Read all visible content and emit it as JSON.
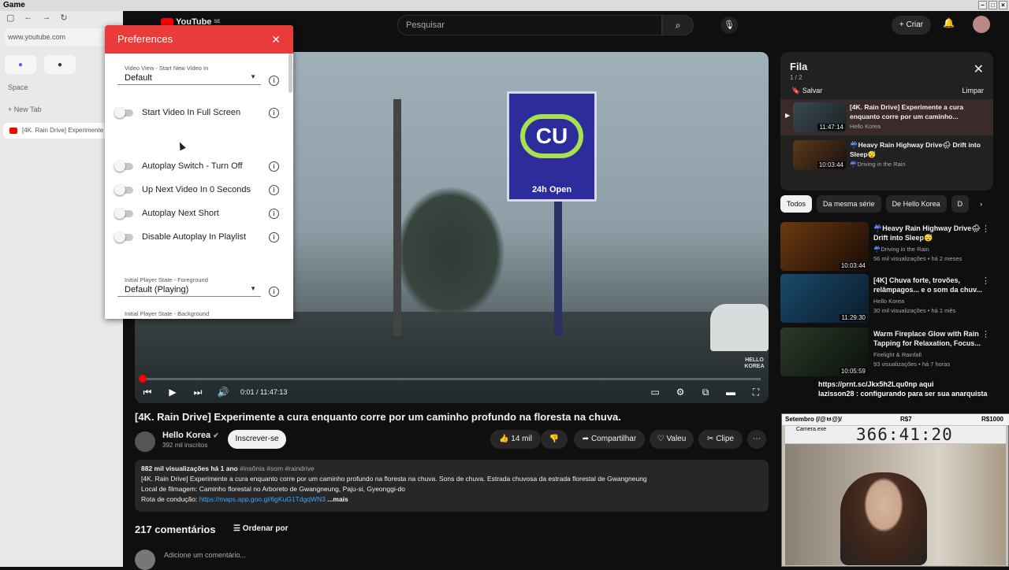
{
  "window": {
    "title": "Game"
  },
  "browser": {
    "url": "www.youtube.com",
    "space_label": "Space",
    "new_tab_label": "New Tab",
    "tab_label": "[4K. Rain Drive] Experimente"
  },
  "topbar": {
    "logo_label": "YouTube",
    "logo_region": "SE",
    "search_placeholder": "Pesquisar",
    "create_label": "Criar"
  },
  "preferences": {
    "title": "Preferences",
    "video_view_label": "Video View - Start New Video In",
    "video_view_value": "Default",
    "toggles": [
      "Start Video In Full Screen",
      "Autoplay Switch - Turn Off",
      "Up Next Video In 0 Seconds",
      "Autoplay Next Short",
      "Disable Autoplay In Playlist"
    ],
    "fg_label": "Initial Player State - Foreground",
    "fg_value": "Default (Playing)",
    "bg_label": "Initial Player State - Background"
  },
  "player": {
    "sign_text": "CU",
    "sign_sub": "24h Open",
    "watermark": "HELLO KOREA",
    "time": "0:01 / 11:47:13",
    "progress": 0.0
  },
  "video": {
    "title": "[4K. Rain Drive] Experimente a cura enquanto corre por um caminho profundo na floresta na chuva.",
    "channel": "Hello Korea",
    "subscribers": "392 mil inscritos",
    "subscribe_label": "Inscrever-se",
    "likes": "14 mil",
    "share_label": "Compartilhar",
    "thanks_label": "Valeu",
    "clip_label": "Clipe",
    "desc_meta": "882 mil visualizações  há 1 ano",
    "desc_tags": "#insônia #som #raindrive",
    "desc_line1": "[4K. Rain Drive] Experimente a cura enquanto corre por um caminho profundo na floresta na chuva. Sons de chuva. Estrada chuvosa da estrada florestal de Gwangneung",
    "desc_line2": "Local de filmagem: Caminho florestal no Arboreto de Gwangneung, Paju-si, Gyeonggi-do",
    "desc_line3_prefix": "Rota de condução: ",
    "desc_link": "https://maps.app.goo.gl/6gKuG1TdgqWN3",
    "desc_more": "...mais",
    "comments_count": "217 comentários",
    "sort_label": "Ordenar por",
    "add_comment": "Adicione um comentário..."
  },
  "queue": {
    "title": "Fila",
    "count": "1 / 2",
    "save_label": "Salvar",
    "clear_label": "Limpar",
    "items": [
      {
        "title": "[4K. Rain Drive] Experimente a cura enquanto corre por um caminho...",
        "channel": "Hello Korea",
        "duration": "11:47:14"
      },
      {
        "title": "☔Heavy Rain Highway Drive🌧 Drift into Sleep😴",
        "channel": "☔Driving in the Rain",
        "duration": "10:03:44"
      }
    ]
  },
  "chips": [
    "Todos",
    "Da mesma série",
    "De Hello Korea",
    "D"
  ],
  "recommendations": [
    {
      "title": "☔Heavy Rain Highway Drive🌧 Drift into Sleep😴",
      "channel": "☔Driving in the Rain",
      "views": "56 mil visualizações • há 2 meses",
      "duration": "10:03:44"
    },
    {
      "title": "[4K] Chuva forte, trovões, relâmpagos... e o som da chuv...",
      "channel": "Hello Korea",
      "views": "30 mil visualizações • há 1 mês",
      "duration": "11:29:30"
    },
    {
      "title": "Warm Fireplace Glow with Rain Tapping for Relaxation, Focus...",
      "channel": "Firelight & Rainfall",
      "views": "93 visualizações • há 7 horas",
      "duration": "10:05:59"
    }
  ],
  "chat_overlay": {
    "line1": "https://prnt.sc/Jkx5h2Lqu0np aqui",
    "line2": "lazisson28 : configurando para ser sua anarquista"
  },
  "camera": {
    "bar_left": "Setembro (/@ㅂ@)/",
    "bar_mid": "R$7",
    "bar_right": "R$1000",
    "head_label": "Camera.exe",
    "timer": "366:41:20"
  }
}
